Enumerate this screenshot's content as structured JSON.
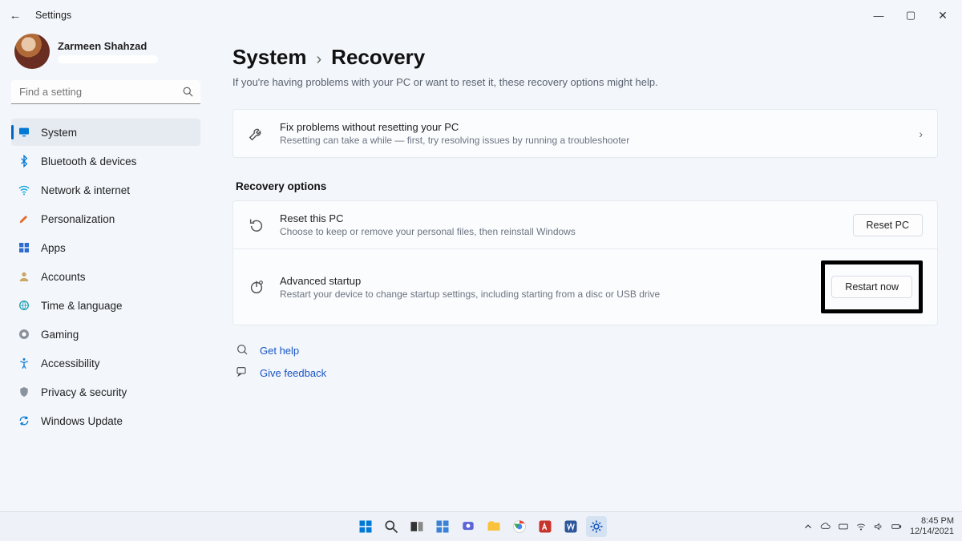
{
  "window": {
    "title": "Settings"
  },
  "profile": {
    "name": "Zarmeen Shahzad"
  },
  "search": {
    "placeholder": "Find a setting"
  },
  "sidebar": {
    "items": [
      {
        "label": "System"
      },
      {
        "label": "Bluetooth & devices"
      },
      {
        "label": "Network & internet"
      },
      {
        "label": "Personalization"
      },
      {
        "label": "Apps"
      },
      {
        "label": "Accounts"
      },
      {
        "label": "Time & language"
      },
      {
        "label": "Gaming"
      },
      {
        "label": "Accessibility"
      },
      {
        "label": "Privacy & security"
      },
      {
        "label": "Windows Update"
      }
    ]
  },
  "breadcrumb": {
    "root": "System",
    "leaf": "Recovery"
  },
  "subtitle": "If you're having problems with your PC or want to reset it, these recovery options might help.",
  "fix_card": {
    "title": "Fix problems without resetting your PC",
    "desc": "Resetting can take a while — first, try resolving issues by running a troubleshooter"
  },
  "section_label": "Recovery options",
  "reset_card": {
    "title": "Reset this PC",
    "desc": "Choose to keep or remove your personal files, then reinstall Windows",
    "button": "Reset PC"
  },
  "advanced_card": {
    "title": "Advanced startup",
    "desc": "Restart your device to change startup settings, including starting from a disc or USB drive",
    "button": "Restart now"
  },
  "links": {
    "help": "Get help",
    "feedback": "Give feedback"
  },
  "taskbar": {
    "time": "8:45 PM",
    "date": "12/14/2021"
  }
}
